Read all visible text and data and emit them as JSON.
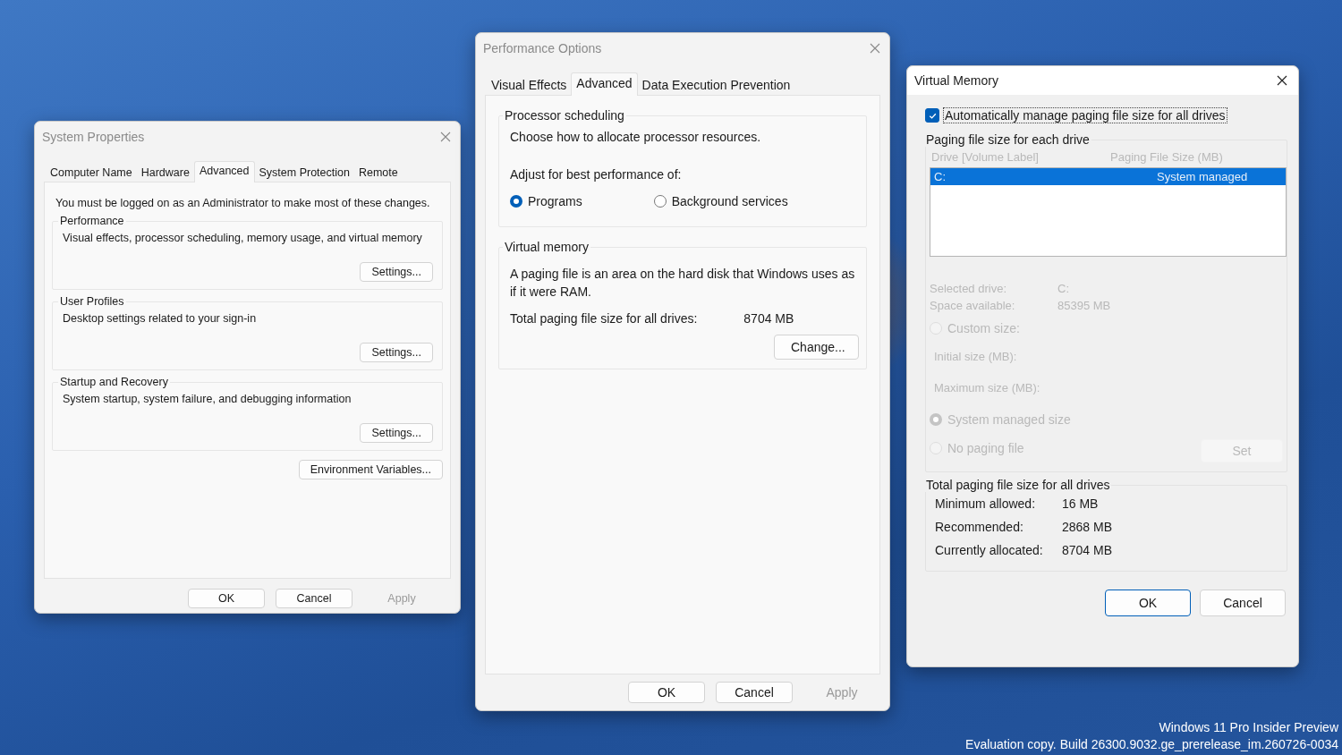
{
  "system_properties": {
    "title": "System Properties",
    "tabs": [
      {
        "label": "Computer Name",
        "selected": false
      },
      {
        "label": "Hardware",
        "selected": false
      },
      {
        "label": "Advanced",
        "selected": true
      },
      {
        "label": "System Protection",
        "selected": false
      },
      {
        "label": "Remote",
        "selected": false
      }
    ],
    "notice": "You must be logged on as an Administrator to make most of these changes.",
    "groups": [
      {
        "title": "Performance",
        "description": "Visual effects, processor scheduling, memory usage, and virtual memory",
        "button": "Settings..."
      },
      {
        "title": "User Profiles",
        "description": "Desktop settings related to your sign-in",
        "button": "Settings..."
      },
      {
        "title": "Startup and Recovery",
        "description": "System startup, system failure, and debugging information",
        "button": "Settings..."
      }
    ],
    "environment_button": "Environment Variables...",
    "buttons": [
      {
        "label": "OK",
        "disabled": false
      },
      {
        "label": "Cancel",
        "disabled": false
      },
      {
        "label": "Apply",
        "disabled": true
      }
    ]
  },
  "performance_options": {
    "title": "Performance Options",
    "tabs": [
      {
        "label": "Visual Effects",
        "selected": false
      },
      {
        "label": "Advanced",
        "selected": true
      },
      {
        "label": "Data Execution Prevention",
        "selected": false
      }
    ],
    "processor_scheduling": {
      "title": "Processor scheduling",
      "description": "Choose how to allocate processor resources.",
      "adjust_label": "Adjust for best performance of:",
      "options": [
        {
          "label": "Programs",
          "selected": true
        },
        {
          "label": "Background services",
          "selected": false
        }
      ]
    },
    "virtual_memory": {
      "title": "Virtual memory",
      "description": "A paging file is an area on the hard disk that Windows uses as if it were RAM.",
      "total_label": "Total paging file size for all drives:",
      "total_value": "8704 MB",
      "button": "Change..."
    },
    "buttons": [
      {
        "label": "OK",
        "disabled": false
      },
      {
        "label": "Cancel",
        "disabled": false
      },
      {
        "label": "Apply",
        "disabled": true
      }
    ]
  },
  "virtual_memory": {
    "title": "Virtual Memory",
    "auto_manage": {
      "label": "Automatically manage paging file size for all drives",
      "checked": true
    },
    "paging": {
      "title": "Paging file size for each drive",
      "disabled": true,
      "columns": [
        "Drive  [Volume Label]",
        "Paging File Size (MB)"
      ],
      "drives": [
        {
          "drive": "C:",
          "size": "System managed",
          "selected": true
        }
      ],
      "selected_drive_label": "Selected drive:",
      "selected_drive_value": "C:",
      "space_label": "Space available:",
      "space_value": "85395 MB",
      "custom_size": {
        "label": "Custom size:",
        "selected": false
      },
      "initial_label": "Initial size (MB):",
      "maximum_label": "Maximum size (MB):",
      "options": [
        {
          "label": "System managed size",
          "selected": true
        },
        {
          "label": "No paging file",
          "selected": false
        }
      ],
      "set_button": "Set"
    },
    "totals": {
      "title": "Total paging file size for all drives",
      "rows": [
        {
          "label": "Minimum allowed:",
          "value": "16 MB"
        },
        {
          "label": "Recommended:",
          "value": "2868 MB"
        },
        {
          "label": "Currently allocated:",
          "value": "8704 MB"
        }
      ]
    },
    "buttons": [
      {
        "label": "OK",
        "disabled": false
      },
      {
        "label": "Cancel",
        "disabled": false
      }
    ]
  },
  "desktop": {
    "edition": "Windows 11 Pro Insider Preview",
    "build": "Evaluation copy. Build 26300.9032.ge_prerelease_im.260726-0034"
  }
}
